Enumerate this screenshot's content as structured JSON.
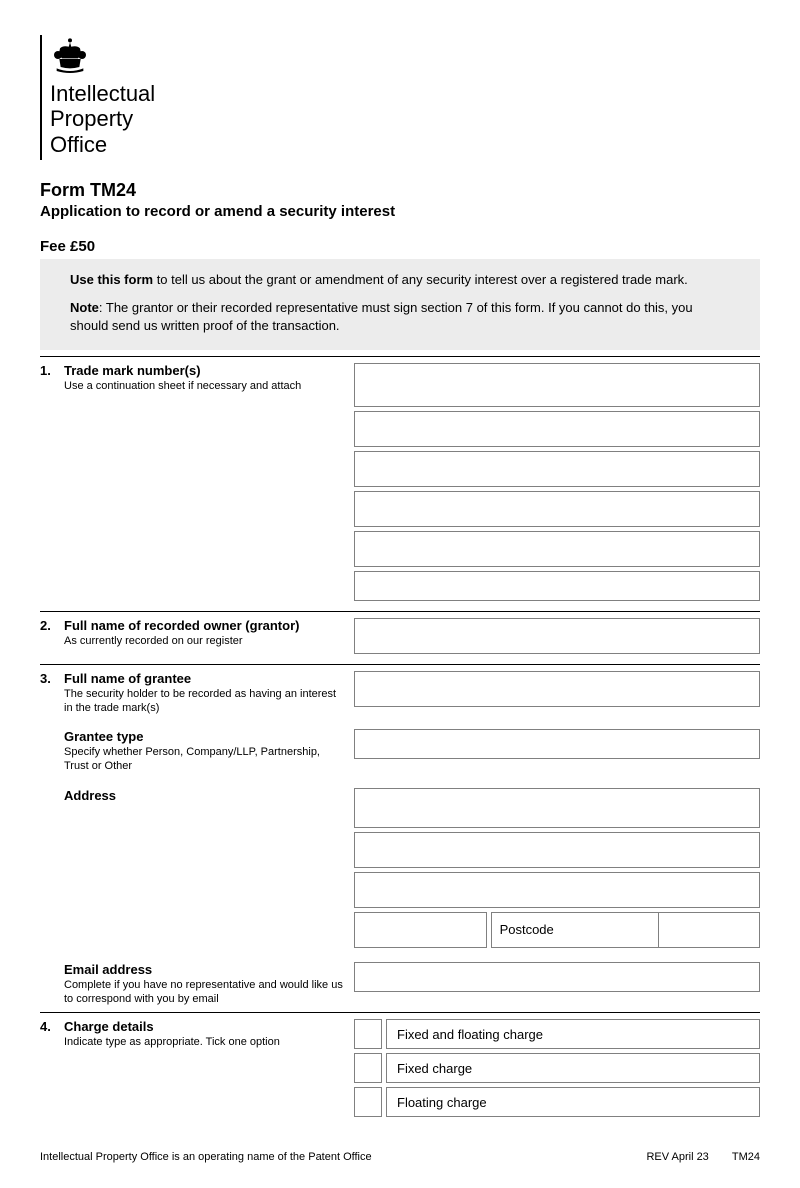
{
  "org": {
    "line1": "Intellectual",
    "line2": "Property",
    "line3": "Office"
  },
  "form": {
    "code": "Form TM24",
    "title": "Application to record or amend a security interest",
    "fee": "Fee £50"
  },
  "instructions": {
    "use_bold": "Use this form",
    "use_rest": " to tell us about the grant or amendment of any security interest over a registered trade mark.",
    "note_bold": "Note",
    "note_rest": ": The grantor or their recorded representative must sign section 7 of this form.  If you cannot do this, you should send us written proof of the transaction."
  },
  "sections": {
    "s1": {
      "num": "1.",
      "title": "Trade mark number(s)",
      "sub": "Use a continuation sheet if necessary and attach"
    },
    "s2": {
      "num": "2.",
      "title": "Full name of recorded owner (grantor)",
      "sub": "As currently recorded on our register"
    },
    "s3": {
      "num": "3.",
      "title": "Full name of grantee",
      "sub": "The security holder to be recorded as having an interest in the trade mark(s)",
      "grantee_type_title": "Grantee type",
      "grantee_type_sub": "Specify whether Person, Company/LLP, Partnership, Trust or Other",
      "address_title": "Address",
      "postcode": "Postcode",
      "email_title": "Email address",
      "email_sub": "Complete if you have no representative and would like us to correspond with you by email"
    },
    "s4": {
      "num": "4.",
      "title": "Charge details",
      "sub": "Indicate type as appropriate. Tick one option",
      "opt1": "Fixed and floating charge",
      "opt2": "Fixed charge",
      "opt3": "Floating charge"
    }
  },
  "footer": {
    "left": "Intellectual Property Office is an operating name of the Patent Office",
    "rev": "REV April 23",
    "code": "TM24"
  }
}
